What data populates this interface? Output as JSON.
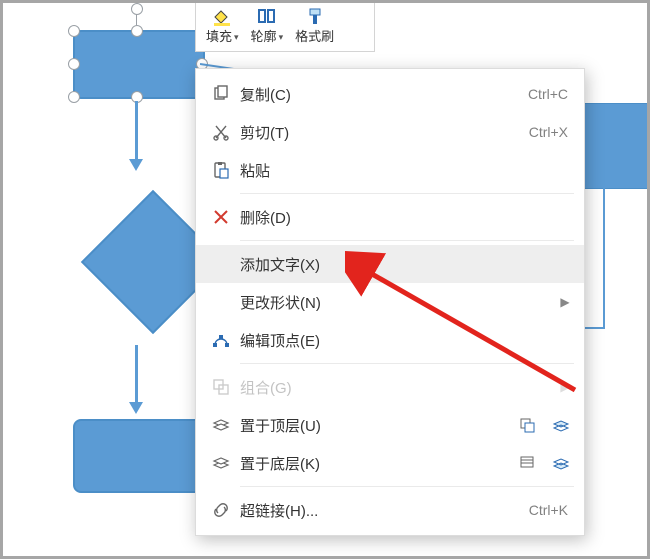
{
  "toolbar": {
    "fill": "填充",
    "outline": "轮廓",
    "format_painter": "格式刷"
  },
  "context_menu": {
    "copy": {
      "label": "复制(C)",
      "shortcut": "Ctrl+C"
    },
    "cut": {
      "label": "剪切(T)",
      "shortcut": "Ctrl+X"
    },
    "paste": {
      "label": "粘贴",
      "shortcut": ""
    },
    "delete": {
      "label": "删除(D)",
      "shortcut": ""
    },
    "add_text": {
      "label": "添加文字(X)",
      "shortcut": ""
    },
    "change_shape": {
      "label": "更改形状(N)",
      "shortcut": ""
    },
    "edit_points": {
      "label": "编辑顶点(E)",
      "shortcut": ""
    },
    "group": {
      "label": "组合(G)",
      "shortcut": ""
    },
    "bring_front": {
      "label": "置于顶层(U)",
      "shortcut": ""
    },
    "send_back": {
      "label": "置于底层(K)",
      "shortcut": ""
    },
    "hyperlink": {
      "label": "超链接(H)...",
      "shortcut": "Ctrl+K"
    }
  },
  "icons": {
    "copy": "copy",
    "cut": "cut",
    "paste": "paste",
    "delete": "delete",
    "edit_points": "edit-points",
    "group": "group",
    "bring_front": "bring-front",
    "send_back": "send-back",
    "hyperlink": "link"
  }
}
